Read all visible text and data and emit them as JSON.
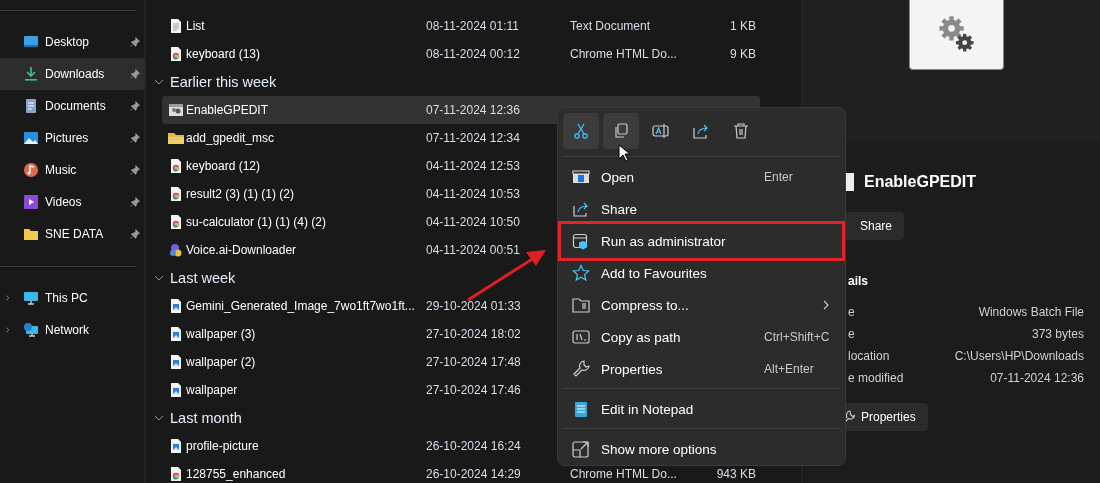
{
  "sidebar": {
    "pinned": [
      {
        "label": "Desktop",
        "kind": "desktop",
        "selected": false,
        "pinned": true
      },
      {
        "label": "Downloads",
        "kind": "downloads",
        "selected": true,
        "pinned": true
      },
      {
        "label": "Documents",
        "kind": "documents",
        "selected": false,
        "pinned": true
      },
      {
        "label": "Pictures",
        "kind": "pictures",
        "selected": false,
        "pinned": true
      },
      {
        "label": "Music",
        "kind": "music",
        "selected": false,
        "pinned": true
      },
      {
        "label": "Videos",
        "kind": "videos",
        "selected": false,
        "pinned": true
      },
      {
        "label": "SNE DATA",
        "kind": "folder",
        "selected": false,
        "pinned": true
      }
    ],
    "locations": [
      {
        "label": "This PC",
        "kind": "pc",
        "expanded": false
      },
      {
        "label": "Network",
        "kind": "network",
        "expanded": false
      }
    ]
  },
  "groups": [
    {
      "files": [
        {
          "name": "List",
          "kind": "text",
          "date": "08-11-2024 01:11",
          "type": "Text Document",
          "size": "1 KB",
          "selected": false
        },
        {
          "name": "keyboard (13)",
          "kind": "chrome",
          "date": "08-11-2024 00:12",
          "type": "Chrome HTML Do...",
          "size": "9 KB",
          "selected": false
        }
      ]
    },
    {
      "title": "Earlier this week",
      "expanded": true,
      "files": [
        {
          "name": "EnableGPEDIT",
          "kind": "batch",
          "date": "07-11-2024 12:36",
          "selected": true
        },
        {
          "name": "add_gpedit_msc",
          "kind": "zip",
          "date": "07-11-2024 12:34",
          "selected": false
        },
        {
          "name": "keyboard (12)",
          "kind": "chrome",
          "date": "04-11-2024 12:53",
          "selected": false
        },
        {
          "name": "result2 (3) (1) (1) (2)",
          "kind": "chrome",
          "date": "04-11-2024 10:53",
          "selected": false
        },
        {
          "name": "su-calculator (1) (1) (4) (2)",
          "kind": "chrome",
          "date": "04-11-2024 10:50",
          "selected": false
        },
        {
          "name": "Voice.ai-Downloader",
          "kind": "app",
          "date": "04-11-2024 00:51",
          "selected": false
        }
      ]
    },
    {
      "title": "Last week",
      "expanded": true,
      "files": [
        {
          "name": "Gemini_Generated_Image_7wo1ft7wo1ft...",
          "kind": "image",
          "date": "29-10-2024 01:33",
          "selected": false
        },
        {
          "name": "wallpaper (3)",
          "kind": "image",
          "date": "27-10-2024 18:02",
          "selected": false
        },
        {
          "name": "wallpaper (2)",
          "kind": "image",
          "date": "27-10-2024 17:48",
          "selected": false
        },
        {
          "name": "wallpaper",
          "kind": "image",
          "date": "27-10-2024 17:46",
          "selected": false
        }
      ]
    },
    {
      "title": "Last month",
      "expanded": true,
      "files": [
        {
          "name": "profile-picture",
          "kind": "image",
          "date": "26-10-2024 16:24",
          "selected": false
        },
        {
          "name": "128755_enhanced",
          "kind": "chrome",
          "date": "26-10-2024 14:29",
          "type": "Chrome HTML Do...",
          "size": "943 KB",
          "selected": false
        }
      ]
    }
  ],
  "details": {
    "title": "EnableGPEDIT",
    "share_button": "Share",
    "section": "ails",
    "properties": [
      {
        "label": "e",
        "value": "Windows Batch File"
      },
      {
        "label": "e",
        "value": "373 bytes"
      },
      {
        "label": "location",
        "value": "C:\\Users\\HP\\Downloads"
      },
      {
        "label": "e modified",
        "value": "07-11-2024 12:36"
      }
    ],
    "properties_button": "Properties"
  },
  "context_menu": {
    "toolbar": [
      {
        "kind": "cut",
        "hovered": true
      },
      {
        "kind": "copy",
        "hovered": true
      },
      {
        "kind": "rename",
        "hovered": false
      },
      {
        "kind": "share",
        "hovered": false
      },
      {
        "kind": "delete",
        "hovered": false
      }
    ],
    "sections": [
      {
        "items": [
          {
            "kind": "open",
            "label": "Open",
            "shortcut": "Enter",
            "submenu": false,
            "highlighted": false
          },
          {
            "kind": "share",
            "label": "Share",
            "submenu": false,
            "highlighted": false
          },
          {
            "kind": "admin",
            "label": "Run as administrator",
            "submenu": false,
            "highlighted": true
          },
          {
            "kind": "star",
            "label": "Add to Favourites",
            "submenu": false,
            "highlighted": false
          },
          {
            "kind": "compress",
            "label": "Compress to...",
            "submenu": true,
            "highlighted": false
          },
          {
            "kind": "path",
            "label": "Copy as path",
            "shortcut": "Ctrl+Shift+C",
            "submenu": false,
            "highlighted": false
          },
          {
            "kind": "properties",
            "label": "Properties",
            "shortcut": "Alt+Enter",
            "submenu": false,
            "highlighted": false
          }
        ]
      },
      {
        "items": [
          {
            "kind": "notepad",
            "label": "Edit in Notepad",
            "submenu": false,
            "highlighted": false
          }
        ]
      },
      {
        "items": [
          {
            "kind": "more",
            "label": "Show more options",
            "submenu": false,
            "highlighted": false
          }
        ]
      }
    ]
  }
}
